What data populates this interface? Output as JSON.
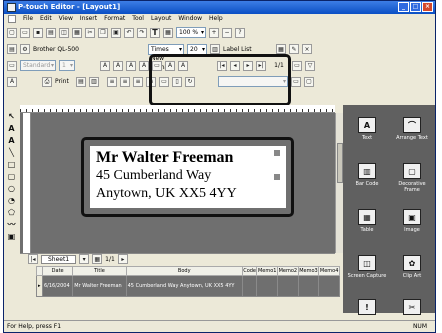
{
  "window": {
    "title": "P-touch Editor - [Layout1]"
  },
  "menubar": {
    "items": [
      "File",
      "Edit",
      "View",
      "Insert",
      "Format",
      "Tool",
      "Layout",
      "Window",
      "Help"
    ]
  },
  "toolbar": {
    "zoom": "100 %",
    "printer": "Brother QL-500",
    "paper": "Standard",
    "copies": "1",
    "print_label": "Print",
    "font_name": "Times New Roman",
    "font_size": "20",
    "label_list": "Label List",
    "page": "1/1"
  },
  "label": {
    "line1": "Mr Walter Freeman",
    "line2": "45 Cumberland Way",
    "line3": "Anytown, UK XX5 4YY"
  },
  "sheet": {
    "tab": "Sheet1",
    "pager": "1/1"
  },
  "database": {
    "columns": [
      "Date",
      "Title",
      "Body",
      "Code",
      "Memo1",
      "Memo2",
      "Memo3",
      "Memo4"
    ],
    "rows": [
      {
        "date": "6/16/2004",
        "title": "Mr Walter Freeman",
        "body": "45 Cumberland Way Anytown, UK XX5 4YY",
        "code": "",
        "memo1": "",
        "memo2": "",
        "memo3": "",
        "memo4": ""
      }
    ]
  },
  "panel": {
    "items": [
      "Text",
      "Arrange Text",
      "Bar Code",
      "Decorative Frame",
      "Table",
      "Image",
      "Screen Capture",
      "Clip Art"
    ]
  },
  "status": {
    "help": "For Help, press F1",
    "num": "NUM"
  }
}
